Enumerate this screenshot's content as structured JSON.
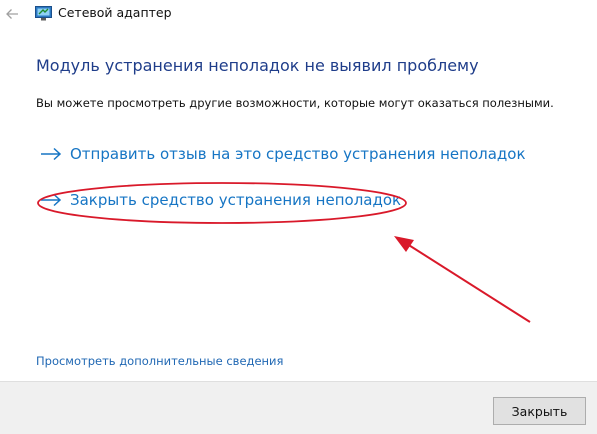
{
  "window": {
    "title": "Сетевой адаптер",
    "back_icon": "back-arrow-icon",
    "app_icon": "troubleshooter-icon"
  },
  "main": {
    "heading": "Модуль устранения неполадок не выявил проблему",
    "subtext": "Вы можете просмотреть другие возможности, которые могут оказаться полезными.",
    "actions": [
      {
        "label": "Отправить отзыв на это средство устранения неполадок",
        "icon": "arrow-right-icon"
      },
      {
        "label": "Закрыть средство устранения неполадок",
        "icon": "arrow-right-icon",
        "highlighted": true
      }
    ],
    "details_link": "Просмотреть дополнительные сведения"
  },
  "footer": {
    "close_label": "Закрыть"
  },
  "colors": {
    "heading": "#1f3d8a",
    "link": "#1675c4",
    "annotation": "#d9192a",
    "footer_bg": "#f0f0f0"
  }
}
